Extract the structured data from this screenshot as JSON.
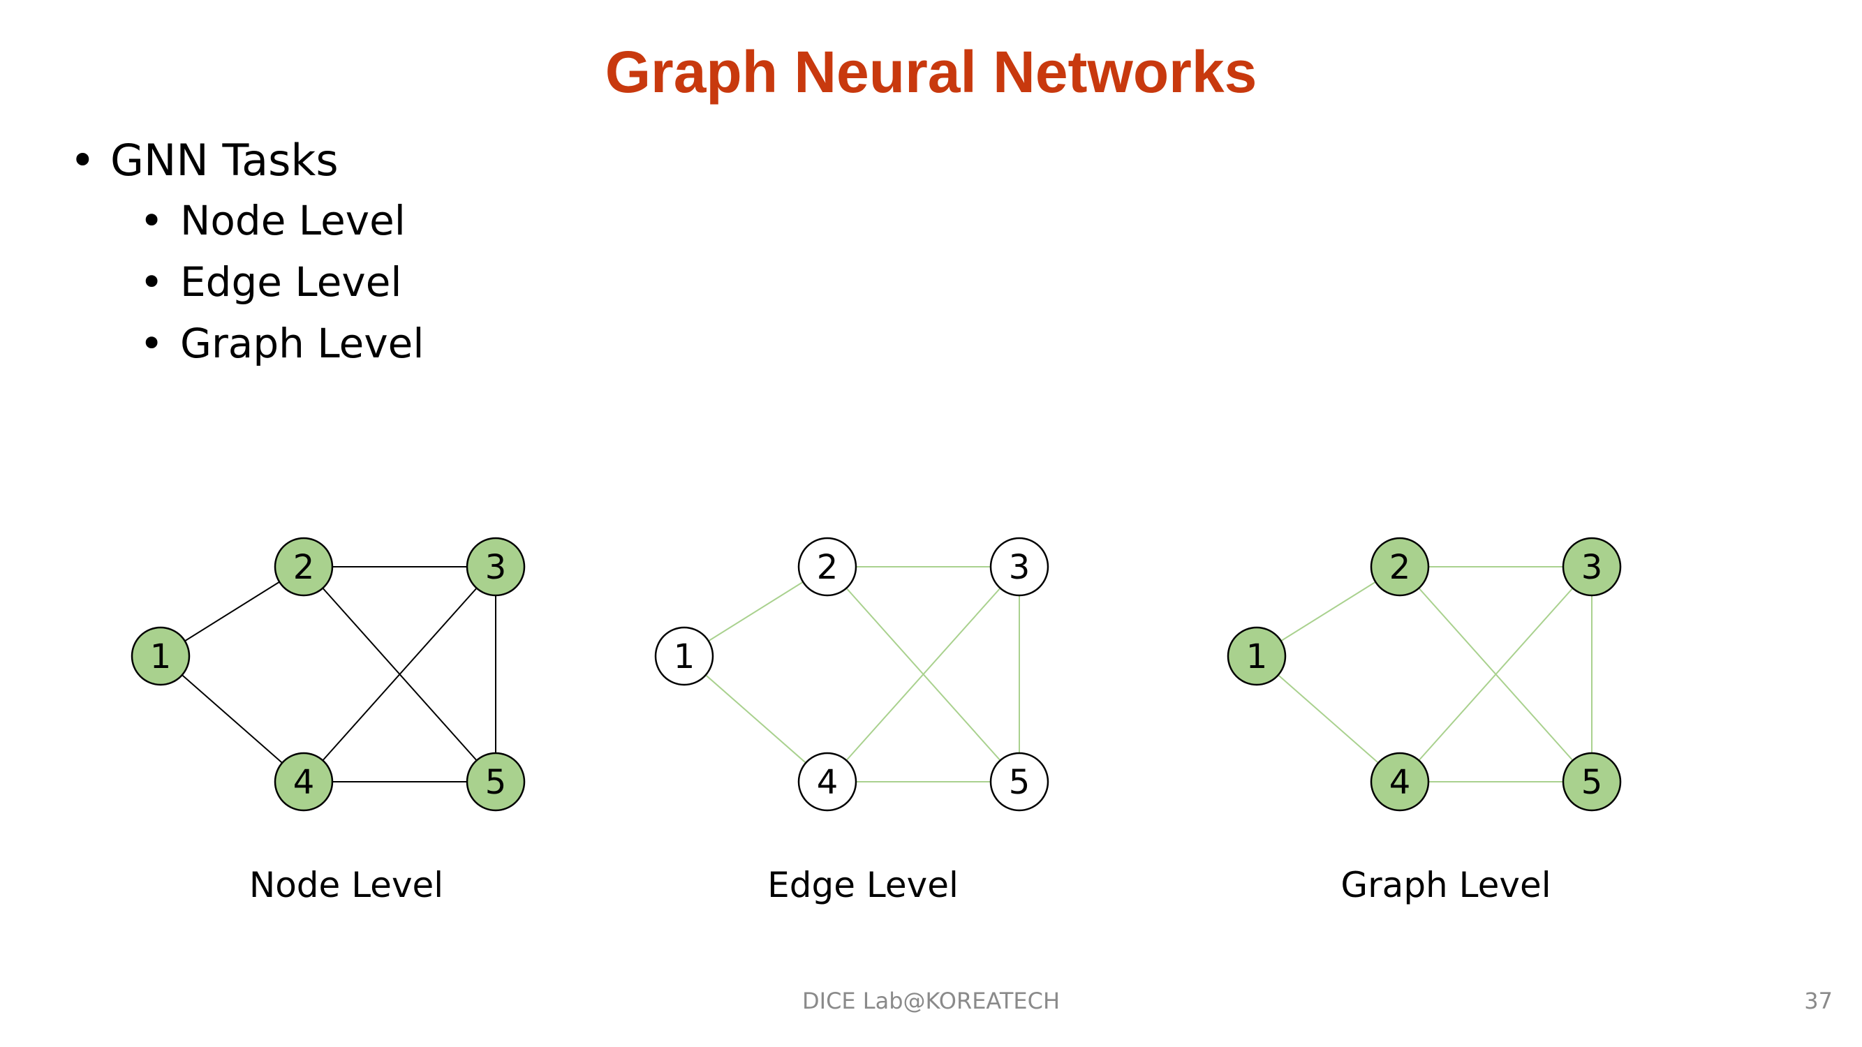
{
  "slide": {
    "title": "Graph Neural Networks",
    "bullet": "GNN Tasks",
    "sub_bullets": [
      "Node Level",
      "Edge Level",
      "Graph Level"
    ],
    "bullet_glyph": "•"
  },
  "graphs": [
    {
      "caption": "Node Level",
      "nodes": [
        {
          "label": "1",
          "filled": true
        },
        {
          "label": "2",
          "filled": true
        },
        {
          "label": "3",
          "filled": true
        },
        {
          "label": "4",
          "filled": true
        },
        {
          "label": "5",
          "filled": true
        }
      ],
      "edges": [
        [
          "1",
          "2"
        ],
        [
          "1",
          "4"
        ],
        [
          "2",
          "3"
        ],
        [
          "2",
          "5"
        ],
        [
          "3",
          "4"
        ],
        [
          "3",
          "5"
        ],
        [
          "4",
          "5"
        ]
      ],
      "edge_color": "#000000"
    },
    {
      "caption": "Edge Level",
      "nodes": [
        {
          "label": "1",
          "filled": false
        },
        {
          "label": "2",
          "filled": false
        },
        {
          "label": "3",
          "filled": false
        },
        {
          "label": "4",
          "filled": false
        },
        {
          "label": "5",
          "filled": false
        }
      ],
      "edges": [
        [
          "1",
          "2"
        ],
        [
          "1",
          "4"
        ],
        [
          "2",
          "3"
        ],
        [
          "2",
          "5"
        ],
        [
          "3",
          "4"
        ],
        [
          "3",
          "5"
        ],
        [
          "4",
          "5"
        ]
      ],
      "edge_color": "#a9d18e"
    },
    {
      "caption": "Graph Level",
      "nodes": [
        {
          "label": "1",
          "filled": true
        },
        {
          "label": "2",
          "filled": true
        },
        {
          "label": "3",
          "filled": true
        },
        {
          "label": "4",
          "filled": true
        },
        {
          "label": "5",
          "filled": true
        }
      ],
      "edges": [
        [
          "1",
          "2"
        ],
        [
          "1",
          "4"
        ],
        [
          "2",
          "3"
        ],
        [
          "2",
          "5"
        ],
        [
          "3",
          "4"
        ],
        [
          "3",
          "5"
        ],
        [
          "4",
          "5"
        ]
      ],
      "edge_color": "#a9d18e"
    }
  ],
  "colors": {
    "title": "#c8390e",
    "node_fill": "#a9d18e",
    "node_empty": "#ffffff",
    "node_stroke": "#000000",
    "footer": "#8a8a8a"
  },
  "footer": {
    "center": "DICE Lab@KOREATECH",
    "page_number": "37"
  }
}
